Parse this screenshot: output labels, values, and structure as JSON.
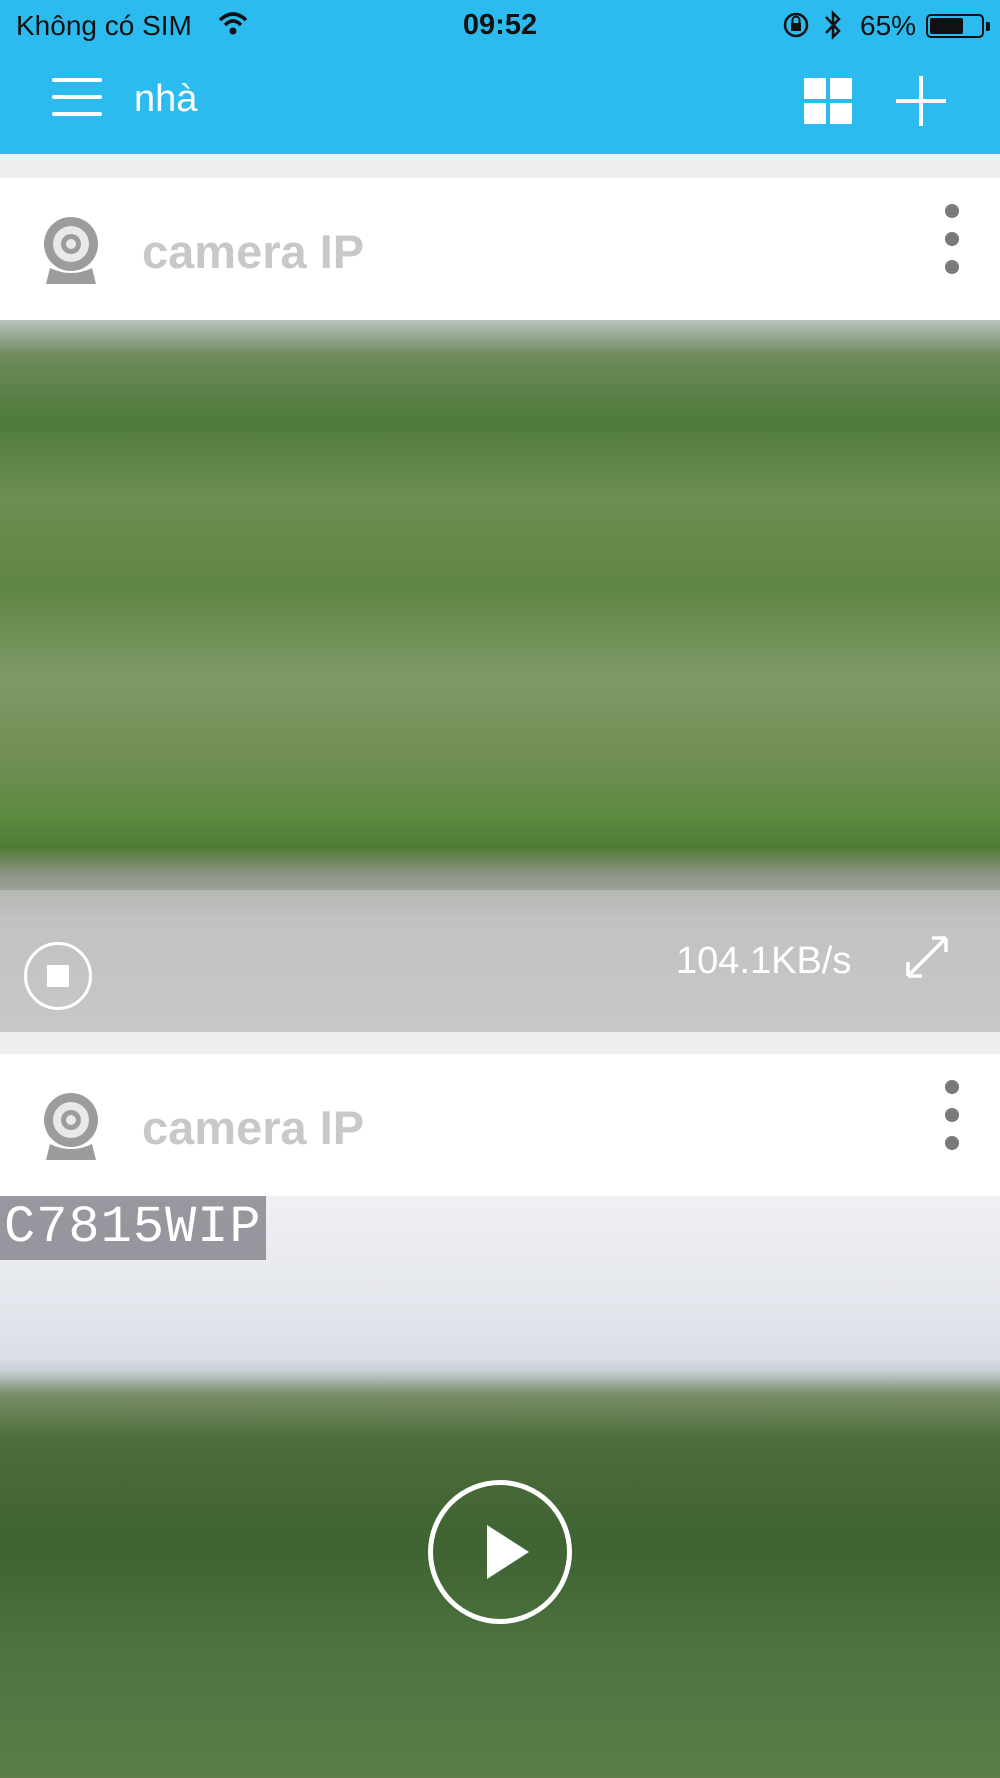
{
  "status_bar": {
    "carrier": "Không có SIM",
    "time": "09:52",
    "battery_percent": "65%",
    "battery_level": 0.65,
    "icons": [
      "wifi-icon",
      "orientation-lock-icon",
      "bluetooth-icon",
      "battery-icon"
    ]
  },
  "nav": {
    "title": "nhà",
    "icons": [
      "menu-icon",
      "grid-view-icon",
      "add-icon"
    ]
  },
  "cameras": [
    {
      "name": "camera IP",
      "state": "playing",
      "speed": "104.1KB/s",
      "icons": [
        "camera-icon",
        "more-icon",
        "stop-icon",
        "fullscreen-icon"
      ]
    },
    {
      "name": "camera IP",
      "state": "paused",
      "osd_text": "C7815WIP",
      "icons": [
        "camera-icon",
        "more-icon",
        "play-icon"
      ]
    }
  ],
  "colors": {
    "header": "#2cbbef",
    "background": "#efefef",
    "camera_name": "#c8c8c8"
  }
}
